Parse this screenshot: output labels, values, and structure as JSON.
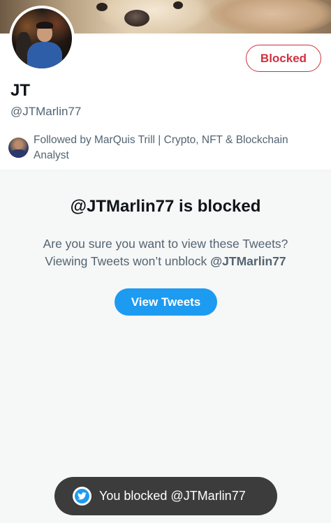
{
  "profile": {
    "name": "JT",
    "handle": "@JTMarlin77",
    "blocked_label": "Blocked",
    "followed_by": "Followed by MarQuis Trill | Crypto, NFT & Blockchain Analyst"
  },
  "blocked_notice": {
    "title": "@JTMarlin77 is blocked",
    "desc_line1": "Are you sure you want to view these Tweets?",
    "desc_line2_prefix": "Viewing Tweets won’t unblock ",
    "desc_line2_handle": "@JTMarlin77",
    "view_button": "View Tweets"
  },
  "toast": {
    "message": "You blocked @JTMarlin77",
    "icon": "twitter-bird-icon"
  },
  "colors": {
    "accent": "#1d9bf0",
    "blocked_red": "#d0313e",
    "secondary_text": "#536471",
    "toast_bg": "#3c3c3c"
  }
}
